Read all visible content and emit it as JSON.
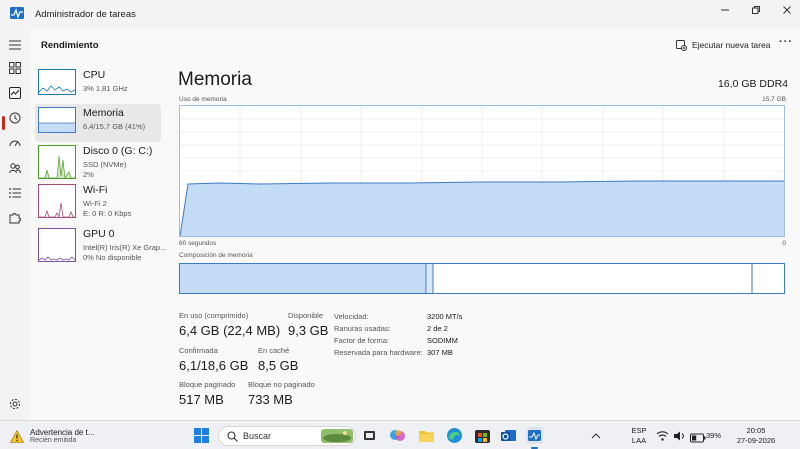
{
  "window": {
    "title": "Administrador de tareas"
  },
  "header": {
    "title": "Rendimiento",
    "run_task_label": "Ejecutar nueva tarea",
    "more_label": "···"
  },
  "perf_items": [
    {
      "name": "CPU",
      "sub1": "3%  1,81 GHz",
      "sub2": "",
      "selected": false,
      "color": "#1a79b5"
    },
    {
      "name": "Memoria",
      "sub1": "6,4/15,7 GB (41%)",
      "sub2": "",
      "selected": true,
      "color": "#2f75c4"
    },
    {
      "name": "Disco 0 (G: C:)",
      "sub1": "SSD (NVMe)",
      "sub2": "2%",
      "selected": false,
      "color": "#4d9a27"
    },
    {
      "name": "Wi-Fi",
      "sub1": "Wi-Fi 2",
      "sub2": "E: 0  R: 0 Kbps",
      "selected": false,
      "color": "#a54a7a"
    },
    {
      "name": "GPU 0",
      "sub1": "Intel(R) Iris(R) Xe Grap...",
      "sub2": "0%  No disponible",
      "selected": false,
      "color": "#7a50a8"
    }
  ],
  "detail": {
    "title": "Memoria",
    "total": "16,0 GB DDR4",
    "usage_label": "Uso de memoria",
    "usage_max": "15,7 GB",
    "axis_left": "60 segundos",
    "axis_right": "0",
    "composition_label": "Composición de memoria",
    "usage_fraction": 0.41
  },
  "stats": {
    "in_use_label": "En uso (comprimido)",
    "in_use_value": "6,4 GB (22,4 MB)",
    "available_label": "Disponible",
    "available_value": "9,3 GB",
    "committed_label": "Confirmada",
    "committed_value": "6,1/18,6 GB",
    "cached_label": "En caché",
    "cached_value": "8,5 GB",
    "paged_label": "Bloque paginado",
    "paged_value": "517 MB",
    "nonpaged_label": "Bloque no paginado",
    "nonpaged_value": "733 MB"
  },
  "specs": [
    {
      "k": "Velocidad:",
      "v": "3200 MT/s"
    },
    {
      "k": "Ranuras usadas:",
      "v": "2 de 2"
    },
    {
      "k": "Factor de forma:",
      "v": "SODIMM"
    },
    {
      "k": "Reservada para hardware:",
      "v": "307 MB"
    }
  ],
  "taskbar": {
    "notif_title": "Advertencia de t...",
    "notif_sub": "Recién emitida",
    "search_placeholder": "Buscar",
    "lang1": "ESP",
    "lang2": "LAA",
    "battery": "39%",
    "time": "20:05",
    "date": "27-09-2026"
  },
  "colors": {
    "memory_line": "#3d79c7",
    "memory_fill": "#c4dcf5",
    "accent_red": "#c42b1c"
  }
}
